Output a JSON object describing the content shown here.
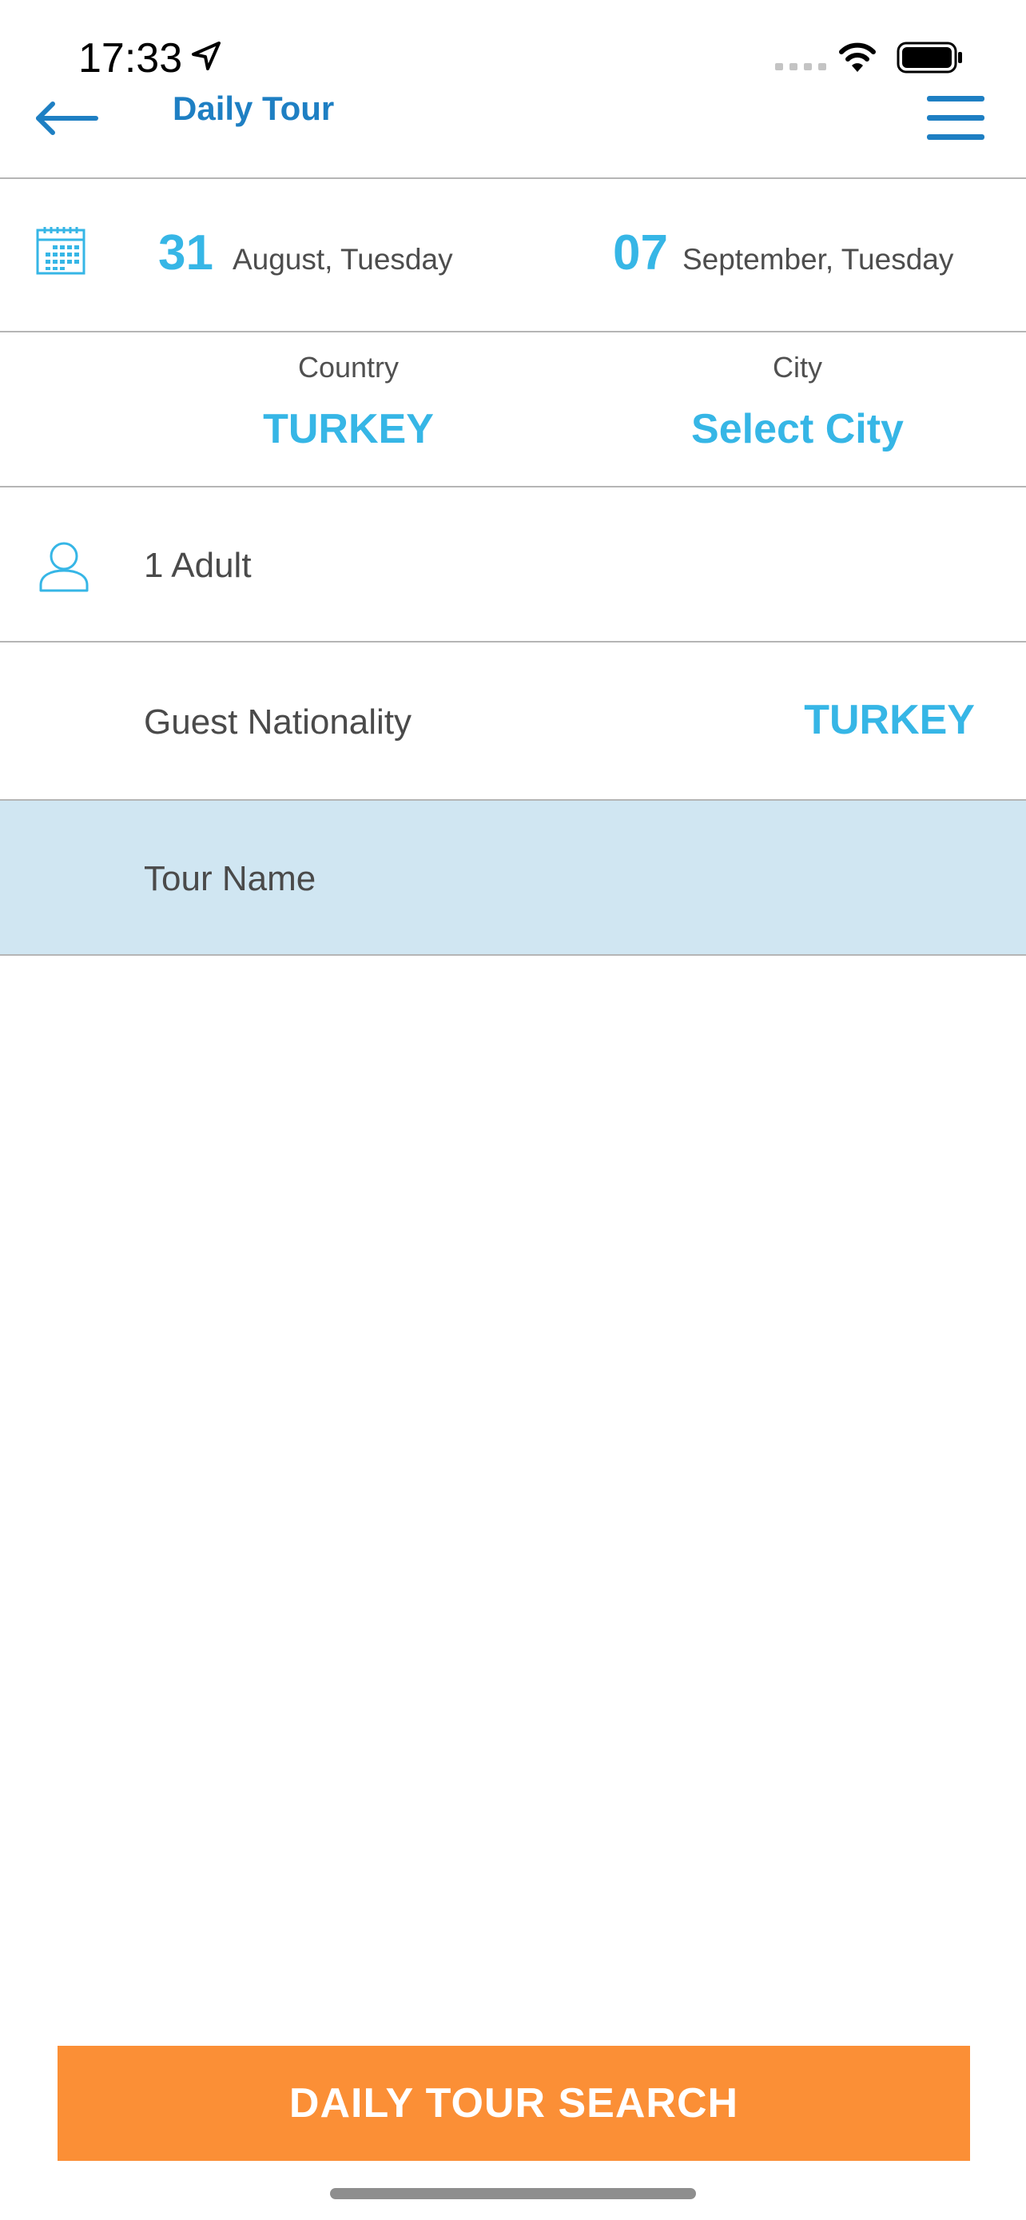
{
  "status_bar": {
    "time": "17:33"
  },
  "header": {
    "title": "Daily Tour",
    "back_icon": "arrow-left-icon",
    "menu_icon": "hamburger-menu-icon"
  },
  "dates": {
    "start": {
      "day": "31",
      "text": "August, Tuesday"
    },
    "end": {
      "day": "07",
      "text": "September, Tuesday"
    }
  },
  "location": {
    "country_label": "Country",
    "country_value": "TURKEY",
    "city_label": "City",
    "city_value": "Select City"
  },
  "guests": {
    "text": "1 Adult"
  },
  "nationality": {
    "label": "Guest Nationality",
    "value": "TURKEY"
  },
  "tour_name": {
    "placeholder": "Tour Name"
  },
  "search_button": {
    "label": "DAILY TOUR SEARCH"
  },
  "colors": {
    "accent_blue": "#36b6e6",
    "title_blue": "#1e7fc3",
    "highlight_band": "#d0e6f2",
    "button_orange": "#fb8f36"
  }
}
